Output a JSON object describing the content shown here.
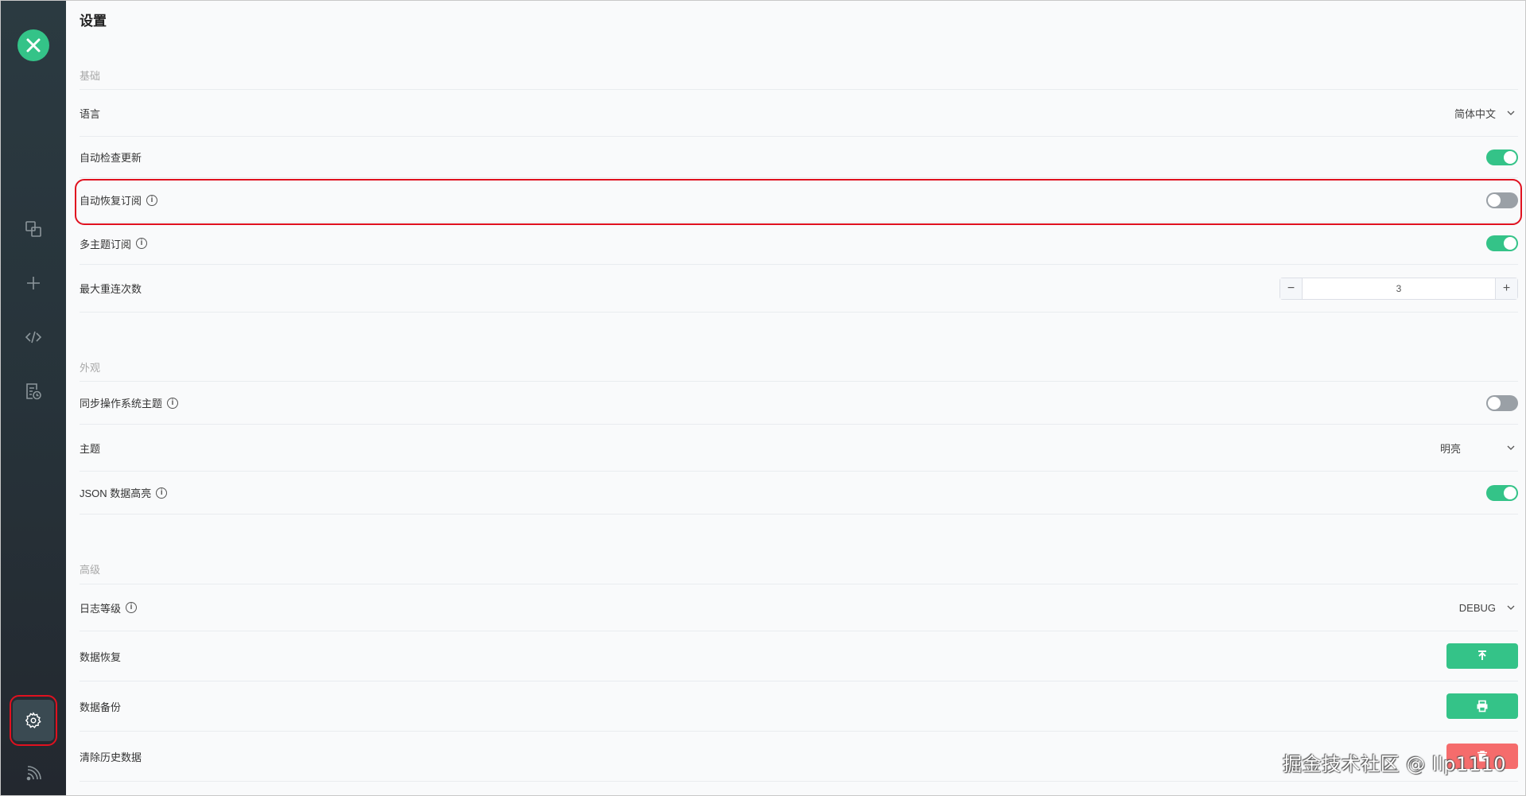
{
  "page_title": "设置",
  "sections": {
    "basic": "基础",
    "appearance": "外观",
    "advanced": "高级"
  },
  "settings": {
    "language": {
      "label": "语言",
      "value": "简体中文"
    },
    "auto_check_update": {
      "label": "自动检查更新",
      "enabled": true
    },
    "auto_resubscribe": {
      "label": "自动恢复订阅",
      "enabled": false
    },
    "multi_topic_subscribe": {
      "label": "多主题订阅",
      "enabled": true
    },
    "max_reconnect": {
      "label": "最大重连次数",
      "value": "3",
      "minus": "−",
      "plus": "+"
    },
    "sync_os_theme": {
      "label": "同步操作系统主题",
      "enabled": false
    },
    "theme": {
      "label": "主题",
      "value": "明亮"
    },
    "json_highlight": {
      "label": "JSON 数据高亮",
      "enabled": true
    },
    "log_level": {
      "label": "日志等级",
      "value": "DEBUG"
    },
    "data_restore": {
      "label": "数据恢复"
    },
    "data_backup": {
      "label": "数据备份"
    },
    "clear_history": {
      "label": "清除历史数据"
    }
  },
  "info_glyph": "i",
  "watermark": "掘金技术社区 @ llp1110",
  "colors": {
    "accent": "#34c388",
    "danger": "#f56c6c",
    "highlight": "#e0111f",
    "sidebar": "#2b3a41"
  },
  "icons": {
    "sidebar": [
      "connections-icon",
      "plus-icon",
      "script-icon",
      "log-icon",
      "settings-icon",
      "feed-icon"
    ],
    "actions": [
      "upload-icon",
      "print-icon",
      "trash-icon"
    ]
  }
}
